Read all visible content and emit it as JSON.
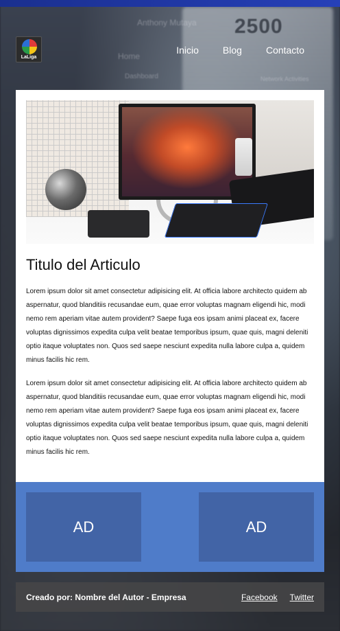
{
  "brand": {
    "logo_text": "LaLiga"
  },
  "nav": {
    "items": [
      "Inicio",
      "Blog",
      "Contacto"
    ]
  },
  "background": {
    "stat_value": "2500",
    "name": "Anthony Mutaya",
    "menu_item": "Home",
    "menu_item_2": "Dashboard",
    "section": "Network Activities"
  },
  "article": {
    "title": "Titulo del Articulo",
    "paragraphs": [
      "Lorem ipsum dolor sit amet consectetur adipisicing elit. At officia labore architecto quidem ab aspernatur, quod blanditiis recusandae eum, quae error voluptas magnam eligendi hic, modi nemo rem aperiam vitae autem provident? Saepe fuga eos ipsam animi placeat ex, facere voluptas dignissimos expedita culpa velit beatae temporibus ipsum, quae quis, magni deleniti optio itaque voluptates non. Quos sed saepe nesciunt expedita nulla labore culpa a, quidem minus facilis hic rem.",
      "Lorem ipsum dolor sit amet consectetur adipisicing elit. At officia labore architecto quidem ab aspernatur, quod blanditiis recusandae eum, quae error voluptas magnam eligendi hic, modi nemo rem aperiam vitae autem provident? Saepe fuga eos ipsam animi placeat ex, facere voluptas dignissimos expedita culpa velit beatae temporibus ipsum, quae quis, magni deleniti optio itaque voluptates non. Quos sed saepe nesciunt expedita nulla labore culpa a, quidem minus facilis hic rem."
    ]
  },
  "ads": {
    "left": "AD",
    "right": "AD"
  },
  "footer": {
    "credit": "Creado por: Nombre del Autor - Empresa",
    "links": [
      "Facebook",
      "Twitter"
    ]
  },
  "colors": {
    "ads_band": "#4f7cc9",
    "ad_box": "#4264a6",
    "footer_bg": "#464648"
  }
}
